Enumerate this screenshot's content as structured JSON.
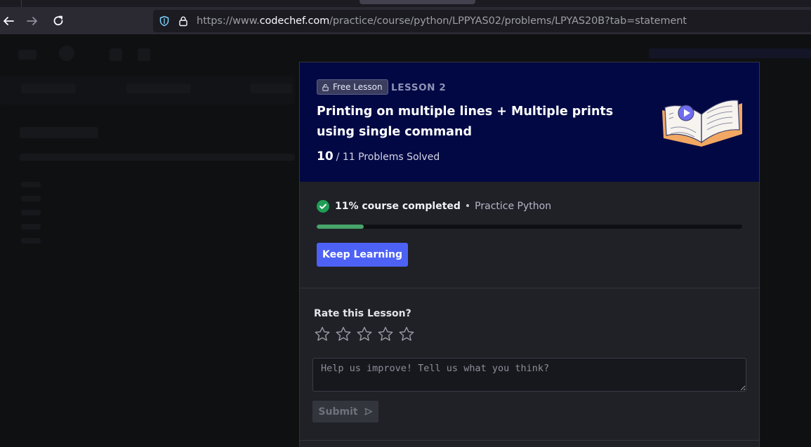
{
  "browser": {
    "url_prefix": "https://www.",
    "url_host": "codechef.com",
    "url_path": "/practice/course/python/LPPYAS02/problems/LPYAS20B?tab=statement"
  },
  "lesson": {
    "badge": "Free Lesson",
    "number": "LESSON 2",
    "title": "Printing on multiple lines + Multiple prints using single command",
    "solved_count": "10",
    "solved_total": "/ 11 Problems Solved"
  },
  "progress": {
    "percent_label": "11% course completed",
    "separator": "•",
    "course_name": "Practice Python",
    "fraction": 0.11,
    "button_label": "Keep Learning"
  },
  "rating": {
    "label": "Rate this Lesson?",
    "stars": 5,
    "placeholder": "Help us improve! Tell us what you think?",
    "submit_label": "Submit"
  },
  "colors": {
    "accent": "#4d62f5",
    "header_bg": "#020844",
    "progress_green": "#47a36a"
  }
}
